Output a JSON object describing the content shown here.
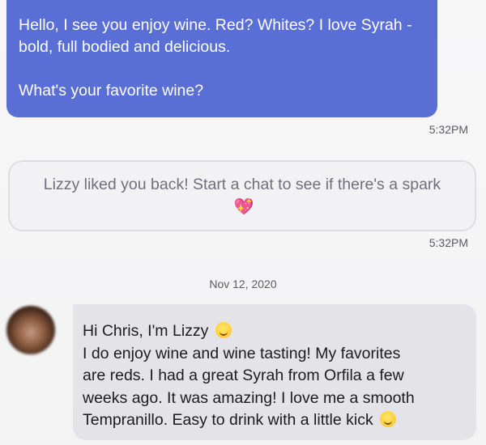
{
  "messages": {
    "outgoing": {
      "line1": "Hello, I see you enjoy wine. Red? Whites? I love Syrah -",
      "line2": "bold, full bodied and delicious.",
      "line3": "What's your favorite wine?",
      "time": "5:32PM"
    },
    "match_notice": {
      "text": "Lizzy liked you back! Start a chat to see if there's a spark",
      "emoji": "💖",
      "time": "5:32PM"
    },
    "date_separator": "Nov 12, 2020",
    "incoming": {
      "line1": "Hi Chris, I'm Lizzy",
      "line2": "I do enjoy wine and wine tasting! My favorites",
      "line3": "are reds. I had a great Syrah from Orfila a few",
      "line4": "weeks ago. It was amazing! I love me a smooth",
      "line5": "Tempranillo. Easy to drink with a little kick",
      "emoji_1": "smiling-face-icon",
      "emoji_2": "winking-face-icon"
    }
  }
}
